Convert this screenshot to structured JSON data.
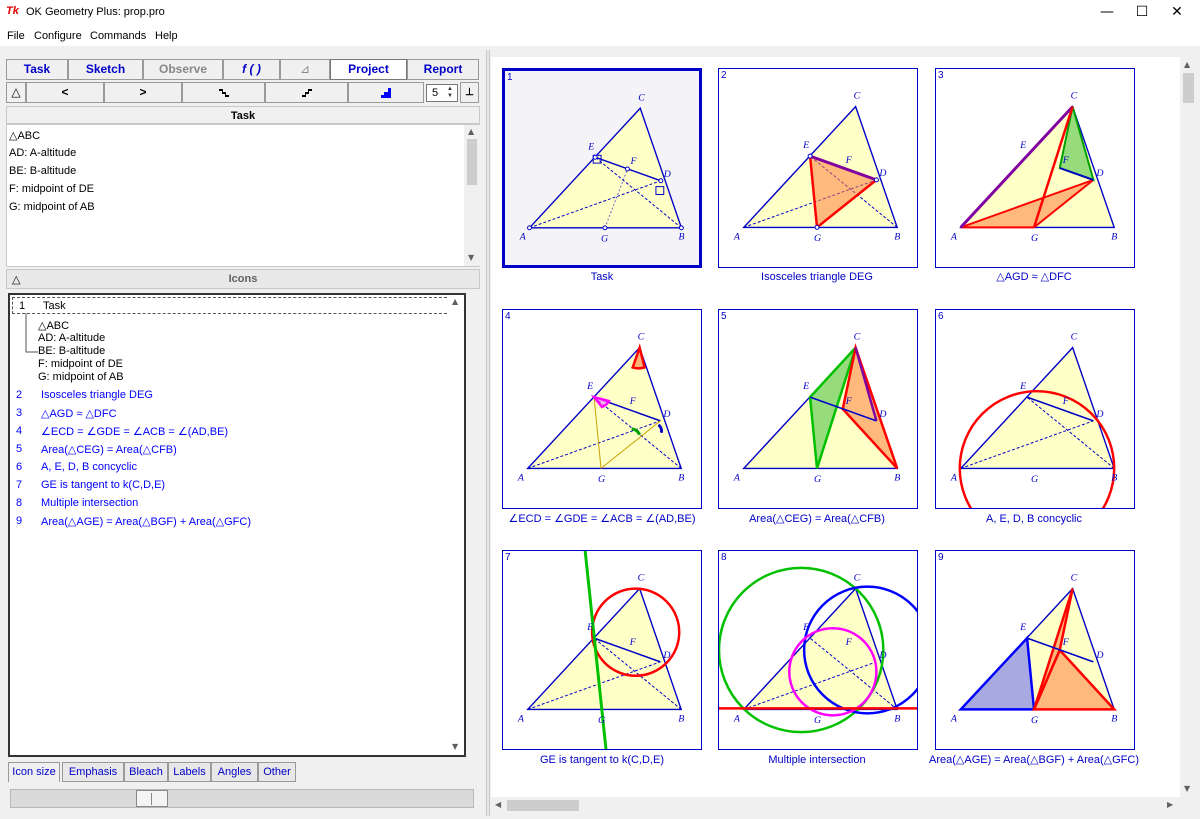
{
  "window": {
    "icon_text": "Tk",
    "title": "OK Geometry Plus:  prop.pro",
    "minimize": "—",
    "maximize": "☐",
    "close": "✕"
  },
  "menu": [
    "File",
    "Configure",
    "Commands",
    "Help"
  ],
  "tabs": [
    {
      "label": "Task",
      "state": "enabled"
    },
    {
      "label": "Sketch",
      "state": "enabled"
    },
    {
      "label": "Observe",
      "state": "disabled"
    },
    {
      "label": "f ( )",
      "state": "enabled"
    },
    {
      "label": "⊿",
      "state": "disabled"
    },
    {
      "label": "Project",
      "state": "active"
    },
    {
      "label": "Report",
      "state": "enabled"
    }
  ],
  "nav": {
    "collapse": "△",
    "prev": "<",
    "next": ">",
    "step_value": "5",
    "pin": "⊥"
  },
  "task_panel": {
    "header": "Task",
    "lines": [
      "△ABC",
      "AD: A-altitude",
      "BE: B-altitude",
      "F: midpoint of DE",
      "G: midpoint of AB"
    ]
  },
  "icons_panel": {
    "collapse": "△",
    "header": "Icons"
  },
  "tree": {
    "root_number": "1",
    "root_label": "Task",
    "children": [
      "△ABC",
      "AD: A-altitude",
      "BE: B-altitude",
      "F: midpoint of DE",
      "G: midpoint of AB"
    ],
    "items": [
      {
        "number": "2",
        "label": "Isosceles triangle DEG"
      },
      {
        "number": "3",
        "label": "△AGD ≈ △DFC"
      },
      {
        "number": "4",
        "label": "∠ECD = ∠GDE = ∠ACB = ∠(AD,BE)"
      },
      {
        "number": "5",
        "label": "Area(△CEG) = Area(△CFB)"
      },
      {
        "number": "6",
        "label": "A, E, D, B concyclic"
      },
      {
        "number": "7",
        "label": "GE is tangent to k(C,D,E)"
      },
      {
        "number": "8",
        "label": "Multiple intersection"
      },
      {
        "number": "9",
        "label": "Area(△AGE) = Area(△BGF) + Area(△GFC)"
      }
    ]
  },
  "bottom_tabs": [
    "Icon size",
    "Emphasis",
    "Bleach",
    "Labels",
    "Angles",
    "Other"
  ],
  "icon_size_slider": 0.29,
  "cards": [
    {
      "number": "1",
      "caption": "Task"
    },
    {
      "number": "2",
      "caption": "Isosceles triangle DEG"
    },
    {
      "number": "3",
      "caption": "△AGD ≈ △DFC"
    },
    {
      "number": "4",
      "caption": "∠ECD = ∠GDE = ∠ACB = ∠(AD,BE)"
    },
    {
      "number": "5",
      "caption": "Area(△CEG) = Area(△CFB)"
    },
    {
      "number": "6",
      "caption": "A, E, D, B concyclic"
    },
    {
      "number": "7",
      "caption": "GE is tangent to k(C,D,E)"
    },
    {
      "number": "8",
      "caption": "Multiple intersection"
    },
    {
      "number": "9",
      "caption": "Area(△AGE) = Area(△BGF) + Area(△GFC)"
    }
  ],
  "point_labels": {
    "A": "A",
    "B": "B",
    "C": "C",
    "D": "D",
    "E": "E",
    "F": "F",
    "G": "G"
  },
  "colors": {
    "accent": "#0000c8",
    "triangle_fill": "#ffffc8",
    "highlight_red": "#ff0000",
    "highlight_green": "#00c000",
    "highlight_purple": "#8000a0",
    "circle_blue": "#0000ff",
    "circle_magenta": "#ff00ff"
  }
}
